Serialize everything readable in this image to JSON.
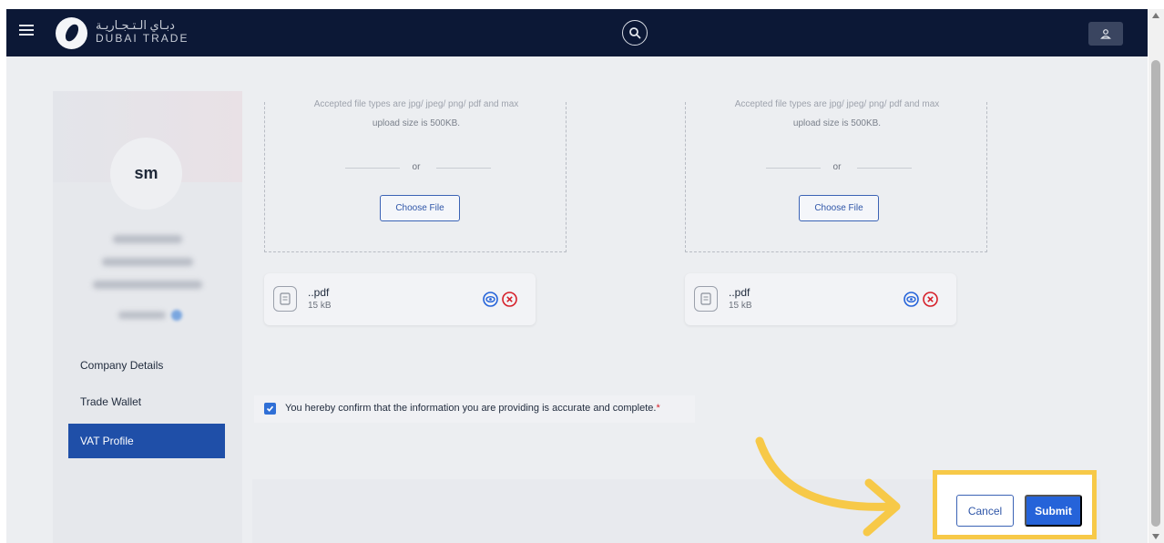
{
  "header": {
    "logo_arabic": "دبـاي الـتـجـاريـة",
    "logo_english": "DUBAI TRADE",
    "menu_icon": "hamburger-icon",
    "search_icon": "search-icon",
    "user_icon": "user-icon"
  },
  "profile": {
    "initials": "sm"
  },
  "sidebar": {
    "items": [
      {
        "label": "Company Details",
        "active": false
      },
      {
        "label": "Trade Wallet",
        "active": false
      },
      {
        "label": "VAT Profile",
        "active": true
      }
    ]
  },
  "uploads": [
    {
      "hint_partial": "Accepted file types are jpg/ jpeg/ png/ pdf and max",
      "hint": "upload size is 500KB.",
      "or_text": "or",
      "choose_label": "Choose File",
      "file_name": "..pdf",
      "file_size": "15 kB"
    },
    {
      "hint_partial": "Accepted file types are jpg/ jpeg/ png/ pdf and max",
      "hint": "upload size is 500KB.",
      "or_text": "or",
      "choose_label": "Choose File",
      "file_name": "..pdf",
      "file_size": "15 kB"
    }
  ],
  "confirm": {
    "checked": true,
    "text": "You hereby confirm that the information you are providing is accurate and complete.",
    "required_mark": "*"
  },
  "actions": {
    "cancel_label": "Cancel",
    "submit_label": "Submit"
  },
  "colors": {
    "topbar": "#0c1836",
    "primary": "#2563d9",
    "active_nav": "#1f4fa8",
    "highlight": "#f7c948",
    "remove": "#d6202a"
  }
}
